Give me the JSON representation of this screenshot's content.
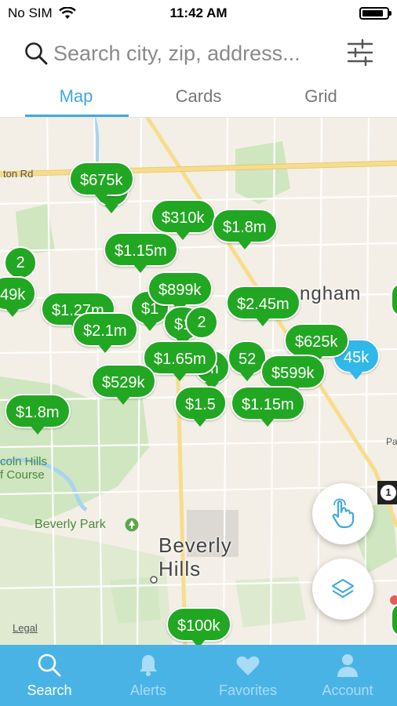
{
  "status_bar": {
    "carrier": "No SIM",
    "time": "11:42 AM"
  },
  "search": {
    "placeholder": "Search city, zip, address..."
  },
  "tabs": [
    {
      "label": "Map",
      "active": true
    },
    {
      "label": "Cards",
      "active": false
    },
    {
      "label": "Grid",
      "active": false
    }
  ],
  "map": {
    "road_label": "ton Rd",
    "city_label_1": "Beverly",
    "city_label_2": "Hills",
    "partial_city_label": "ngham",
    "park_label": "Beverly Park",
    "golf_label_1": "coln Hills",
    "golf_label_2": "f Course",
    "highway_shield": "1",
    "edge_label": "Pa",
    "legal": "Legal"
  },
  "pins": {
    "p675k": "$675k",
    "p_m_hidden": "m",
    "p310k": "$310k",
    "p18m_top": "$1.8m",
    "p115m_top": "$1.15m",
    "cluster_left": "2",
    "p49k": "49k",
    "p127m": "$1.27m",
    "p21m": "$2.1m",
    "p899k": "$899k",
    "p1_partial": "$1",
    "cluster_center": "2",
    "p245m": "$2.45m",
    "p625k": "$625k",
    "p45k": "45k",
    "p165m": "$1.65m",
    "p52_partial": "52",
    "p599k": "$599k",
    "p529k": "$529k",
    "p18m_left": "$1.8m",
    "p15_partial": "$1.5",
    "p115m_bottom": "$1.15m",
    "p100k": "$100k"
  },
  "bottom_nav": [
    {
      "label": "Search",
      "active": true
    },
    {
      "label": "Alerts",
      "active": false
    },
    {
      "label": "Favorites",
      "active": false
    },
    {
      "label": "Account",
      "active": false
    }
  ],
  "colors": {
    "accent": "#3fa9e0",
    "pin_green": "#22a722",
    "pin_blue": "#2fb8e8",
    "nav_bg": "#4ab3e6"
  }
}
